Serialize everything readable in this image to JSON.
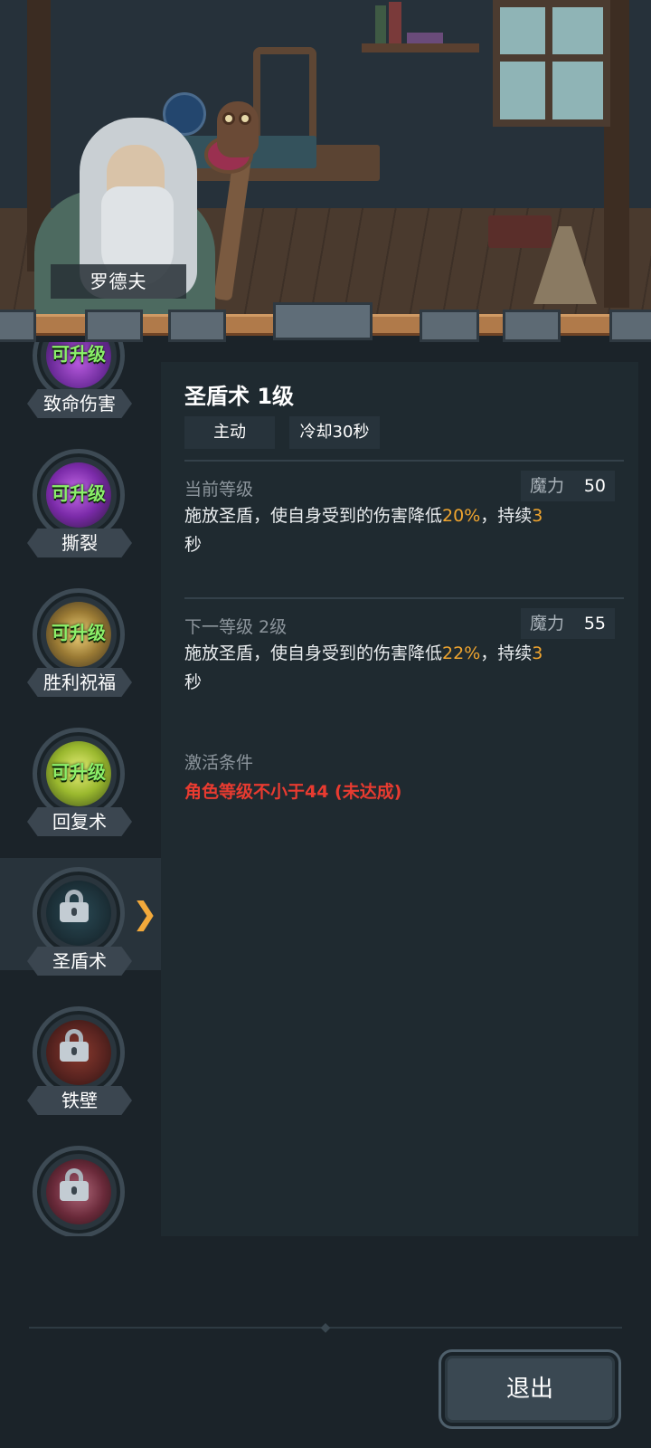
{
  "npc": {
    "name": "罗德夫"
  },
  "skills": [
    {
      "name": "致命伤害",
      "upgrade_tag": "可升级",
      "state": "upgradable",
      "icon": "fatal-damage-icon",
      "color": "#7a3aa8"
    },
    {
      "name": "撕裂",
      "upgrade_tag": "可升级",
      "state": "upgradable",
      "icon": "tear-icon",
      "color": "#8a35b8"
    },
    {
      "name": "胜利祝福",
      "upgrade_tag": "可升级",
      "state": "upgradable",
      "icon": "victory-blessing-icon",
      "color": "#c9a23a"
    },
    {
      "name": "回复术",
      "upgrade_tag": "可升级",
      "state": "upgradable",
      "icon": "heal-icon",
      "color": "#a8c83a"
    },
    {
      "name": "圣盾术",
      "upgrade_tag": "",
      "state": "locked-selected",
      "icon": "lock-icon",
      "color": "#1f3a44"
    },
    {
      "name": "铁壁",
      "upgrade_tag": "",
      "state": "locked",
      "icon": "lock-icon",
      "color": "#6a2a24"
    },
    {
      "name": "",
      "upgrade_tag": "",
      "state": "locked",
      "icon": "lock-icon",
      "color": "#8a3a4a"
    }
  ],
  "detail": {
    "title": "圣盾术 1级",
    "type_tag": "主动",
    "cooldown_tag": "冷却30秒",
    "current": {
      "label": "当前等级",
      "mana_label": "魔力",
      "mana_value": "50",
      "desc_pre": "施放圣盾，使自身受到的伤害降低",
      "desc_pct": "20%",
      "desc_mid": "，持续",
      "desc_num": "3",
      "desc_tail": "秒"
    },
    "next": {
      "label": "下一等级 2级",
      "mana_label": "魔力",
      "mana_value": "55",
      "desc_pre": "施放圣盾，使自身受到的伤害降低",
      "desc_pct": "22%",
      "desc_mid": "，持续",
      "desc_num": "3",
      "desc_tail": "秒"
    },
    "activation": {
      "label": "激活条件",
      "condition": "角色等级不小于44 (未达成)"
    }
  },
  "footer": {
    "exit_label": "退出"
  },
  "colors": {
    "highlight": "#f0a52f",
    "condition_red": "#e83b30",
    "upgrade_green": "#8bf06a",
    "select_arrow": "#f2a93b"
  }
}
